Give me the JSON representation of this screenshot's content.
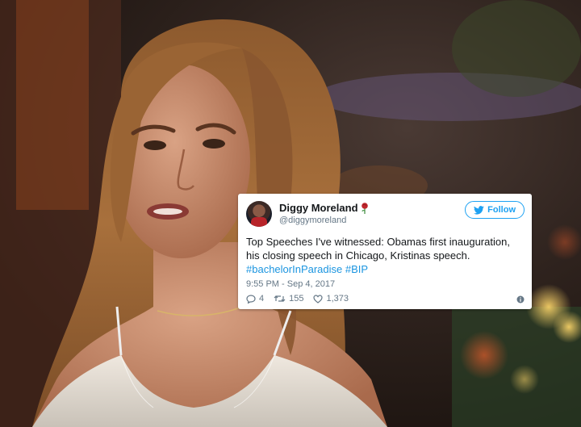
{
  "tweet": {
    "display_name": "Diggy Moreland",
    "handle": "@diggymoreland",
    "follow_label": "Follow",
    "text_main": "Top Speeches I've witnessed: Obamas first inauguration, his closing speech in Chicago, Kristinas speech.",
    "hashtags": [
      "#bachelorInParadise",
      "#BIP"
    ],
    "timestamp": "9:55 PM - Sep 4, 2017",
    "replies": "4",
    "retweets": "155",
    "likes": "1,373"
  },
  "icons": {
    "name_badge": "rose-icon",
    "follow": "bird-icon",
    "reply": "reply-icon",
    "retweet": "retweet-icon",
    "like": "heart-icon",
    "info": "info-icon"
  },
  "colors": {
    "twitter_blue": "#1da1f2",
    "hashtag": "#1b95e0",
    "muted_text": "#657786",
    "rose": "#c0272d"
  }
}
